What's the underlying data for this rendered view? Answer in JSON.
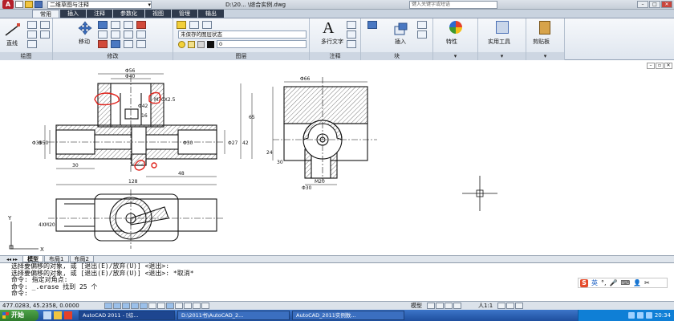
{
  "title_bar": {
    "workspace": "二维草图与注释",
    "title": "D:\\20... \\综合实例.dwg",
    "search_placeholder": "键入关键字或短语"
  },
  "ribbon_tabs": [
    "常用",
    "插入",
    "注释",
    "参数化",
    "视图",
    "管理",
    "输出"
  ],
  "ribbon": {
    "draw_panel": "绘图",
    "line_label": "直线",
    "modify_panel": "修改",
    "move_label": "移动",
    "layers_panel": "图层",
    "layer_state": "未保存的图层状态",
    "layer_current": "0",
    "annotation_panel": "注释",
    "mtext_label": "多行文字",
    "block_panel": "块",
    "insert_label": "插入",
    "properties_label": "特性",
    "utilities_label": "实用工具",
    "clipboard_label": "剪贴板"
  },
  "drawing": {
    "dims": [
      "Φ56",
      "Φ40",
      "Φ42",
      "M30X2.5",
      "16",
      "65",
      "Φ35",
      "Φ50",
      "Φ27",
      "Φ30",
      "Φ66",
      "Φ30",
      "42",
      "30",
      "48",
      "128",
      "M20",
      "30",
      "24",
      "4XM20"
    ],
    "ucs_x": "X",
    "ucs_y": "Y"
  },
  "layout_tabs": [
    "模型",
    "布局1",
    "布局2"
  ],
  "command_history": [
    "选择要偏移的对象, 或 [退出(E)/放弃(U)] <退出>:",
    "选择要偏移的对象, 或 [退出(E)/放弃(U)] <退出>: *取消*",
    "命令: 指定对角点:",
    "命令: _.erase 找到 25 个",
    "命令:"
  ],
  "status": {
    "coordinates": "477.0283, 45.2358, 0.0000",
    "model_label": "模型",
    "scale": "1:1"
  },
  "ime": {
    "label": "英"
  },
  "taskbar": {
    "start": "开始",
    "tasks": [
      "AutoCAD 2011 - [综...",
      "D:\\2011书\\AutoCAD_2...",
      "AutoCAD_2011实例数..."
    ],
    "clock": "20:34"
  },
  "colors": {
    "annotation_red": "#e0231c",
    "taskbar_blue": "#2457a8"
  }
}
